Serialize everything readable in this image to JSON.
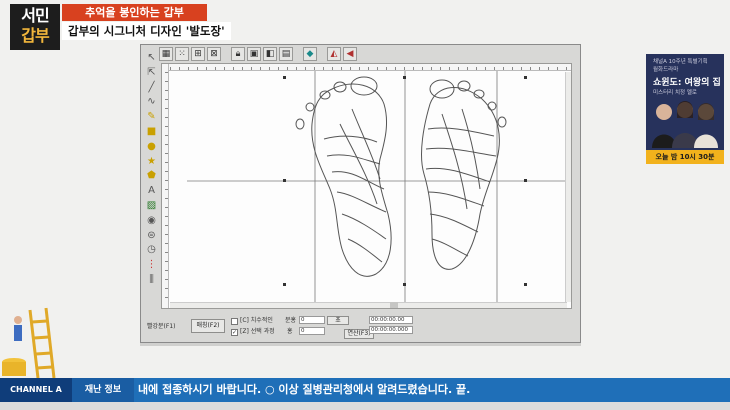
{
  "broadcast": {
    "logo_line1": "서민",
    "logo_line2": "갑부",
    "caption_top": "추억을 봉인하는 갑부",
    "caption_main": "갑부의 시그니처 디자인 '발도장'"
  },
  "panel": {
    "btn1": "빨강분(F1)",
    "btn2": "매칭(F2)",
    "check1_label": "[C] 치수적인",
    "check2_label": "[Z] 선택 과정",
    "label_a": "분홍",
    "label_b": "홍",
    "field1": "0",
    "field2": "0",
    "unit": "초",
    "btn3": "연산(F3)",
    "time1": "00:00:00.00",
    "time2": "00:00:00.000"
  },
  "ad": {
    "line1": "채널A 10주년 특별기획",
    "line2": "월화드라마",
    "title": "쇼윈도: 여왕의 집",
    "sub": "미스터리 치정 멜로",
    "time": "오늘 밤 10시 30분"
  },
  "ticker": {
    "brand": "CHANNEL A",
    "label": "재난 정보",
    "text": "내에 접종하시기 바랍니다. ○ 이상 질병관리청에서 알려드렸습니다.  끝."
  },
  "colors": {
    "caption_red": "#d8411f",
    "ticker_blue": "#1f6fb8",
    "ad_navy": "#27325c",
    "ad_yellow": "#f2b21c"
  }
}
